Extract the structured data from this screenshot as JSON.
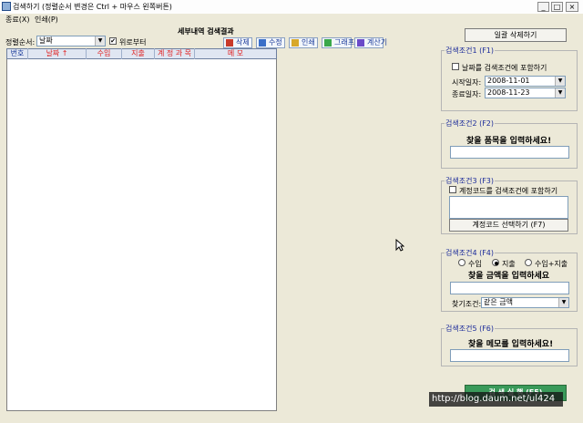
{
  "window": {
    "title": "검색하기",
    "subtitle": "(정렬순서 변경은 Ctrl + 마우스 왼쪽버튼)",
    "min": "_",
    "max": "□",
    "close": "×"
  },
  "menu": [
    {
      "label": "종료(X)"
    },
    {
      "label": "인쇄(P)"
    }
  ],
  "results": {
    "title": "세부내역 검색결과",
    "sort_label": "정렬순서:",
    "sort_value": "날짜",
    "from_top_label": "위로부터",
    "from_top_checked": true,
    "buttons": {
      "delete": "삭제",
      "edit": "수정",
      "print": "인쇄",
      "graph": "그래프",
      "calc": "계산기"
    },
    "columns": [
      "번호",
      "날짜 ↑",
      "수입",
      "지출",
      "계 정 과 목",
      "메  모"
    ]
  },
  "right": {
    "bulk_delete": "일괄 삭제하기",
    "cond1": {
      "title": "검색조건1 (F1)",
      "include_date": "날짜를 검색조건에 포함하기",
      "start_label": "시작일자:",
      "start_value": "2008-11-01",
      "end_label": "종료일자:",
      "end_value": "2008-11-23"
    },
    "cond2": {
      "title": "검색조건2 (F2)",
      "hint": "찾을 품목을 입력하세요!"
    },
    "cond3": {
      "title": "검색조건3 (F3)",
      "include_account": "계정코드를 검색조건에 포함하기",
      "select_button": "계정코드 선택하기 (F7)"
    },
    "cond4": {
      "title": "검색조건4 (F4)",
      "radios": [
        "수입",
        "지출",
        "수입+지출"
      ],
      "hint": "찾을 금액을 입력하세요",
      "find_label": "찾기조건:",
      "find_value": "같은 금액"
    },
    "cond5": {
      "title": "검색조건5 (F6)",
      "hint": "찾을 메모를 입력하세요!"
    },
    "search_button": "검 색 실 행 (F5)"
  },
  "watermark": "http://blog.daum.net/ul424"
}
